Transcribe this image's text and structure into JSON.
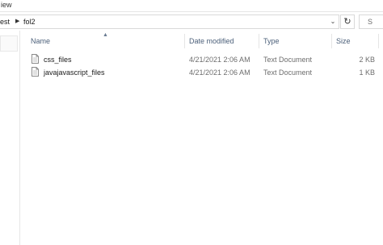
{
  "ribbon": {
    "view_tab": "iew"
  },
  "address": {
    "crumbs": [
      "est",
      "fol2"
    ],
    "refresh_symbol": "↻",
    "dropdown_symbol": "⌄"
  },
  "search": {
    "placeholder": "S"
  },
  "columns": {
    "name": "Name",
    "date_modified": "Date modified",
    "type": "Type",
    "size": "Size"
  },
  "files": [
    {
      "name": "css_files",
      "date_modified": "4/21/2021 2:06 AM",
      "type": "Text Document",
      "size": "2 KB"
    },
    {
      "name": "javajavascript_files",
      "date_modified": "4/21/2021 2:06 AM",
      "type": "Text Document",
      "size": "1 KB"
    }
  ],
  "icons": {
    "file": "text-document-icon",
    "refresh": "refresh-icon",
    "sort": "sort-ascending-icon",
    "crumb_sep": "chevron-right-icon"
  },
  "colors": {
    "header_text": "#4c607a",
    "meta_text": "#6d6d6d",
    "border": "#d9d9d9"
  }
}
